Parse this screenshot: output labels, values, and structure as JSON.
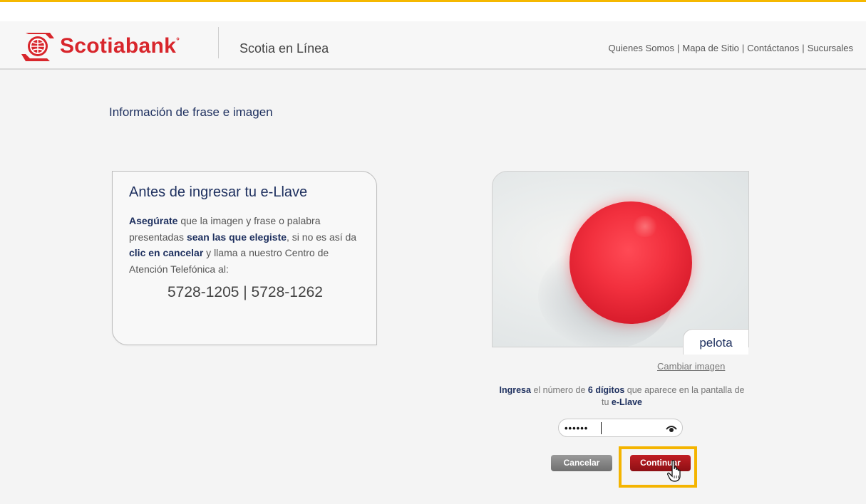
{
  "header": {
    "logo_text": "Scotiabank",
    "logo_mark": "°",
    "app_name": "Scotia en Línea",
    "links": [
      "Quienes Somos",
      "Mapa de Sitio",
      "Contáctanos",
      "Sucursales"
    ]
  },
  "page": {
    "title": "Información de frase e imagen"
  },
  "info_card": {
    "title": "Antes de ingresar tu e-Llave",
    "body": [
      {
        "text": "Asegúrate",
        "bold": true
      },
      {
        "text": " que la imagen y frase o palabra presentadas ",
        "bold": false
      },
      {
        "text": "sean las que elegiste",
        "bold": true
      },
      {
        "text": ", si no es así da ",
        "bold": false
      },
      {
        "text": "clic en cancelar",
        "bold": true
      },
      {
        "text": " y llama a nuestro Centro de Atención Telefónica al:",
        "bold": false
      }
    ],
    "phones": "5728-1205 | 5728-1262"
  },
  "security_image": {
    "phrase": "pelota",
    "change_link": "Cambiar imagen"
  },
  "otp": {
    "instructions": [
      {
        "text": "Ingresa",
        "bold": true
      },
      {
        "text": " el número de ",
        "bold": false
      },
      {
        "text": "6 dígitos",
        "bold": true
      },
      {
        "text": " que aparece en la pantalla de tu ",
        "bold": false
      },
      {
        "text": "e-Llave",
        "bold": true
      }
    ],
    "masked_value": "••••••",
    "toggle_icon": "eye-icon"
  },
  "buttons": {
    "cancel": "Cancelar",
    "continue": "Continuar"
  },
  "colors": {
    "brand_red": "#d8262c",
    "navy": "#1d2f5e",
    "highlight": "#f4b400"
  }
}
